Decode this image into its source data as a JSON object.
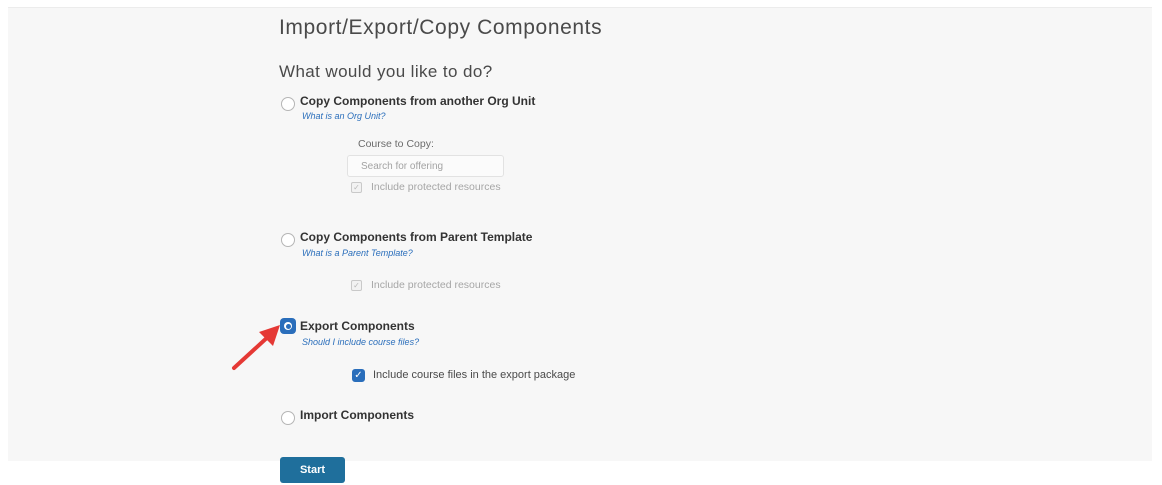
{
  "page": {
    "title": "Import/Export/Copy Components",
    "question": "What would you like to do?"
  },
  "options": [
    {
      "label": "Copy Components from another Org Unit",
      "help_link": "What is an Org Unit?",
      "selected": false,
      "course_to_copy_label": "Course to Copy:",
      "search_placeholder": "Search for offering",
      "protected_label": "Include protected resources"
    },
    {
      "label": "Copy Components from Parent Template",
      "help_link": "What is a Parent Template?",
      "selected": false,
      "protected_label": "Include protected resources"
    },
    {
      "label": "Export Components",
      "help_link": "Should I include course files?",
      "selected": true,
      "include_files_label": "Include course files in the export package",
      "include_files_checked": true
    },
    {
      "label": "Import Components",
      "selected": false
    }
  ],
  "actions": {
    "start_label": "Start"
  },
  "colors": {
    "accent": "#2a6ebb",
    "button": "#1f6f9c",
    "annotation_arrow": "#e53935",
    "panel_background": "#f7f7f7"
  },
  "icons": {
    "arrow": "annotation-arrow-icon",
    "check": "checkmark-icon"
  }
}
